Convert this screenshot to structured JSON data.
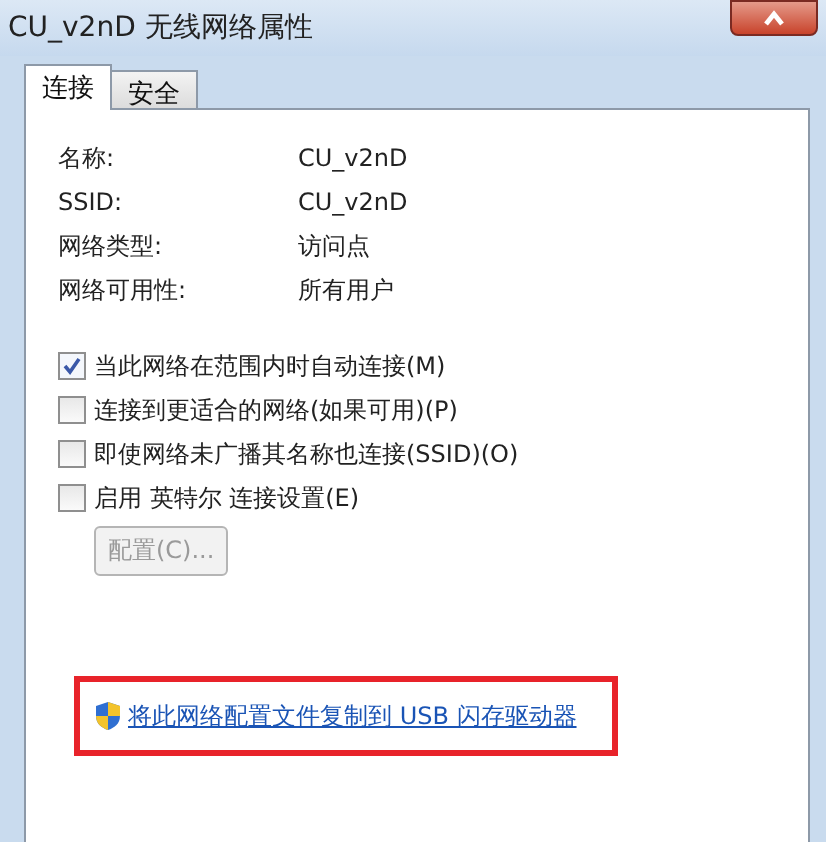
{
  "window": {
    "title": "CU_v2nD 无线网络属性"
  },
  "tabs": [
    {
      "label": "连接",
      "selected": true
    },
    {
      "label": "安全",
      "selected": false
    }
  ],
  "info": [
    {
      "label": "名称:",
      "value": "CU_v2nD"
    },
    {
      "label": "SSID:",
      "value": "CU_v2nD"
    },
    {
      "label": "网络类型:",
      "value": "访问点"
    },
    {
      "label": "网络可用性:",
      "value": "所有用户"
    }
  ],
  "options": [
    {
      "label": "当此网络在范围内时自动连接(M)",
      "checked": true
    },
    {
      "label": "连接到更适合的网络(如果可用)(P)",
      "checked": false
    },
    {
      "label": "即使网络未广播其名称也连接(SSID)(O)",
      "checked": false
    },
    {
      "label": "启用 英特尔 连接设置(E)",
      "checked": false
    }
  ],
  "config_button": {
    "label": "配置(C)...",
    "disabled": true
  },
  "link": {
    "label": "将此网络配置文件复制到 USB 闪存驱动器",
    "highlighted": true
  }
}
